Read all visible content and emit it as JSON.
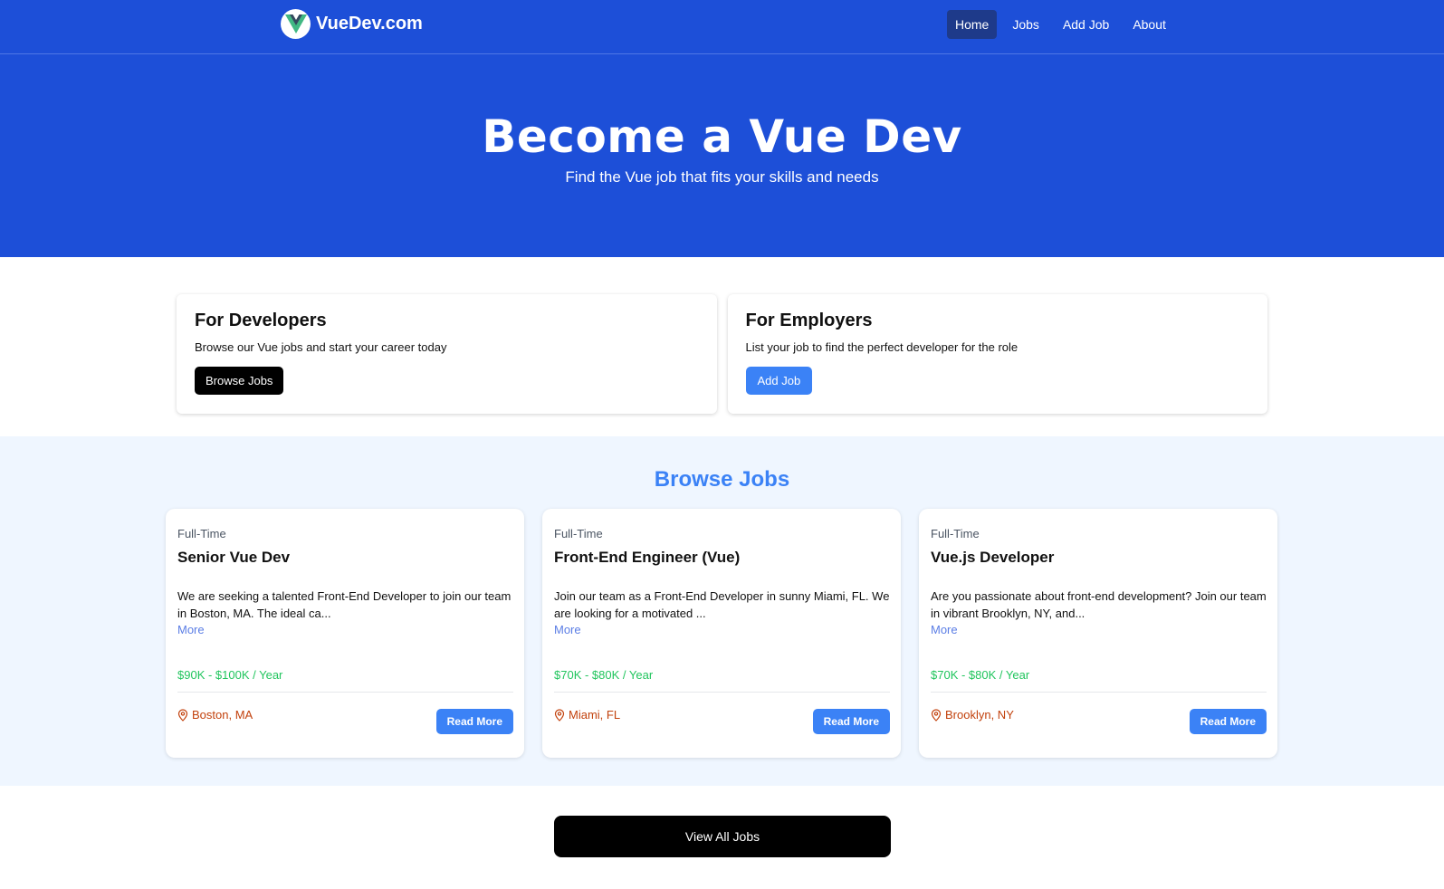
{
  "nav": {
    "brand": "VueDev.com",
    "links": [
      {
        "label": "Home"
      },
      {
        "label": "Jobs"
      },
      {
        "label": "Add Job"
      },
      {
        "label": "About"
      }
    ]
  },
  "hero": {
    "title": "Become a Vue Dev",
    "subtitle": "Find the Vue job that fits your skills and needs"
  },
  "roles": {
    "developers": {
      "title": "For Developers",
      "text": "Browse our Vue jobs and start your career today",
      "button": "Browse Jobs"
    },
    "employers": {
      "title": "For Employers",
      "text": "List your job to find the perfect developer for the role",
      "button": "Add Job"
    }
  },
  "browse": {
    "title": "Browse Jobs",
    "jobs": [
      {
        "type": "Full-Time",
        "title": "Senior Vue Dev",
        "description": "We are seeking a talented Front-End Developer to join our team in Boston, MA. The ideal ca...",
        "more": "More",
        "salary": "$90K - $100K / Year",
        "location": "Boston, MA",
        "read_more": "Read More"
      },
      {
        "type": "Full-Time",
        "title": "Front-End Engineer (Vue)",
        "description": "Join our team as a Front-End Developer in sunny Miami, FL. We are looking for a motivated ...",
        "more": "More",
        "salary": "$70K - $80K / Year",
        "location": "Miami, FL",
        "read_more": "Read More"
      },
      {
        "type": "Full-Time",
        "title": "Vue.js Developer",
        "description": "Are you passionate about front-end development? Join our team in vibrant Brooklyn, NY, and...",
        "more": "More",
        "salary": "$70K - $80K / Year",
        "location": "Brooklyn, NY",
        "read_more": "Read More"
      }
    ]
  },
  "view_all": "View All Jobs",
  "colors": {
    "primary": "#1d4fd8",
    "accent": "#3b82f6",
    "salary": "#22c55e",
    "location": "#c2410c",
    "active_nav": "#1e3a8a"
  }
}
